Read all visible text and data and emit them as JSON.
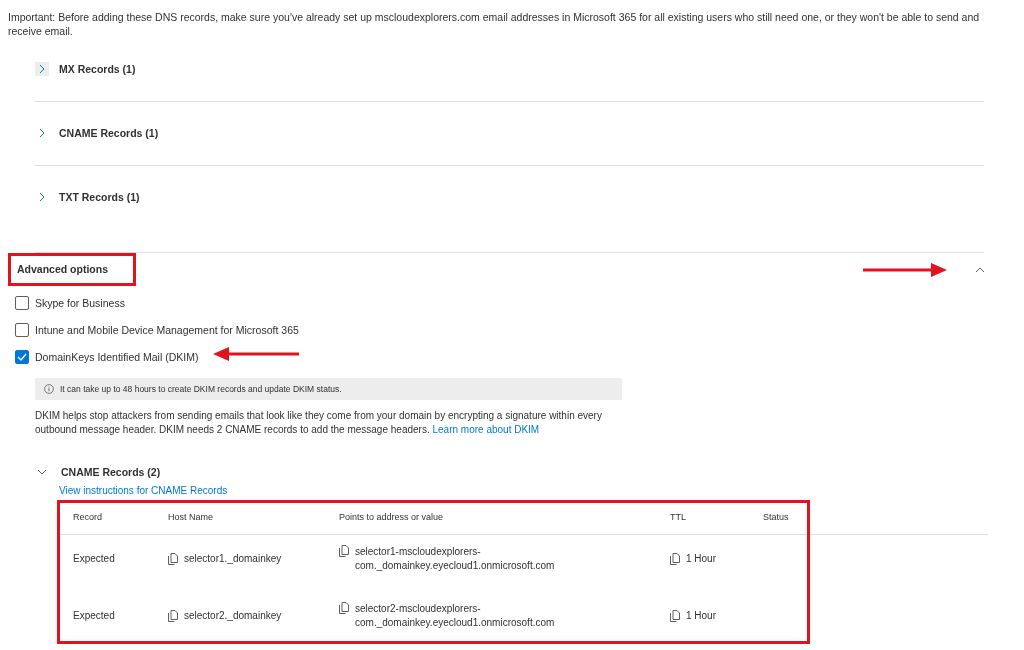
{
  "intro": "Important: Before adding these DNS records, make sure you've already set up mscloudexplorers.com email addresses in Microsoft 365 for all existing users who still need one, or they won't be able to send and receive email.",
  "sections": [
    {
      "label": "MX Records (1)",
      "expanded": false
    },
    {
      "label": "CNAME Records (1)",
      "expanded": false
    },
    {
      "label": "TXT Records (1)",
      "expanded": false
    }
  ],
  "advanced": {
    "title": "Advanced options",
    "expanded": true,
    "options": [
      {
        "label": "Skype for Business",
        "checked": false
      },
      {
        "label": "Intune and Mobile Device Management for Microsoft 365",
        "checked": false
      },
      {
        "label": "DomainKeys Identified Mail (DKIM)",
        "checked": true
      }
    ],
    "info": "It can take up to 48 hours to create DKIM records and update DKIM status.",
    "description": "DKIM helps stop attackers from sending emails that look like they come from your domain by encrypting a signature within every outbound message header. DKIM needs 2 CNAME records to add the message headers.",
    "learn_more": "Learn more about DKIM",
    "records": {
      "title": "CNAME Records (2)",
      "expanded": true,
      "link": "View instructions for CNAME Records",
      "columns": [
        "Record",
        "Host Name",
        "Points to address or value",
        "TTL",
        "Status"
      ],
      "rows": [
        {
          "record": "Expected",
          "host": "selector1._domainkey",
          "value": "selector1-mscloudexplorers-com._domainkey.eyecloud1.onmicrosoft.com",
          "ttl": "1 Hour"
        },
        {
          "record": "Expected",
          "host": "selector2._domainkey",
          "value": "selector2-mscloudexplorers-com._domainkey.eyecloud1.onmicrosoft.com",
          "ttl": "1 Hour"
        }
      ]
    }
  }
}
